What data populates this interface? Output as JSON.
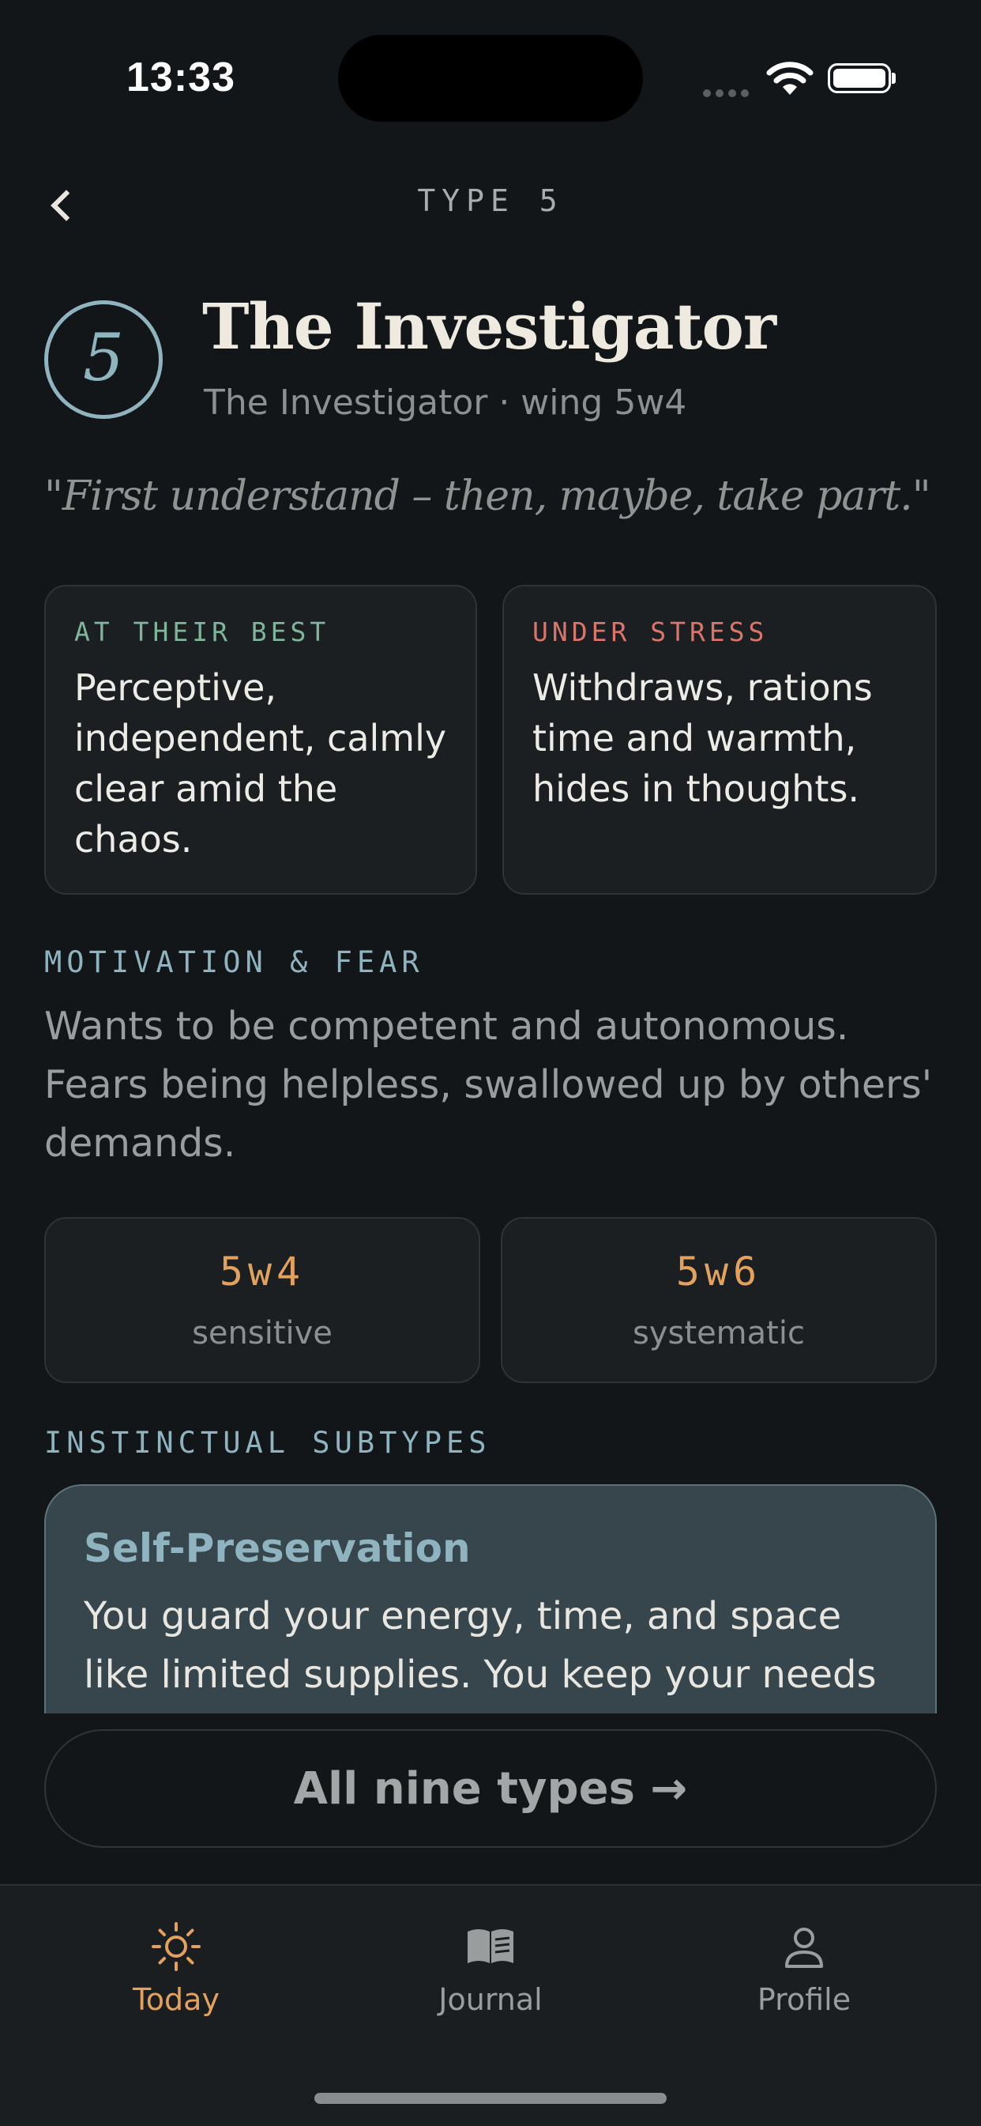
{
  "status_bar": {
    "time": "13:33"
  },
  "header": {
    "back_label": "‹",
    "title": "TYPE 5"
  },
  "type_info": {
    "number": "5",
    "name": "The Investigator",
    "subtitle": "The Investigator · wing 5w4",
    "quote": "\"First understand – then, maybe, take part.\""
  },
  "best": {
    "label": "AT THEIR BEST",
    "text": "Perceptive, independent, calmly clear amid the chaos.",
    "color": "#7fb59a"
  },
  "stress": {
    "label": "UNDER STRESS",
    "text": "Withdraws, rations time and warmth, hides in thoughts.",
    "color": "#d9756a"
  },
  "motivation": {
    "label": "MOTIVATION & FEAR",
    "text": "Wants to be competent and autonomous. Fears being helpless, swallowed up by others' demands."
  },
  "wings": [
    {
      "code": "5w4",
      "desc": "sensitive"
    },
    {
      "code": "5w6",
      "desc": "systematic"
    }
  ],
  "subtypes": {
    "label": "INSTINCTUAL SUBTYPES",
    "current": {
      "title": "Self-Preservation",
      "text": "You guard your energy, time, and space like limited supplies. You keep your needs"
    }
  },
  "all_types_button": "All nine types →",
  "tabs": [
    {
      "label": "Today",
      "icon": "sun-icon",
      "active": true,
      "color": "#e3a15e"
    },
    {
      "label": "Journal",
      "icon": "book-icon",
      "active": false,
      "color": "#9a9d9e"
    },
    {
      "label": "Profile",
      "icon": "person-icon",
      "active": false,
      "color": "#9a9d9e"
    }
  ],
  "colors": {
    "background": "#121619",
    "accent": "#8fb3bf",
    "highlight": "#e3a15e"
  }
}
